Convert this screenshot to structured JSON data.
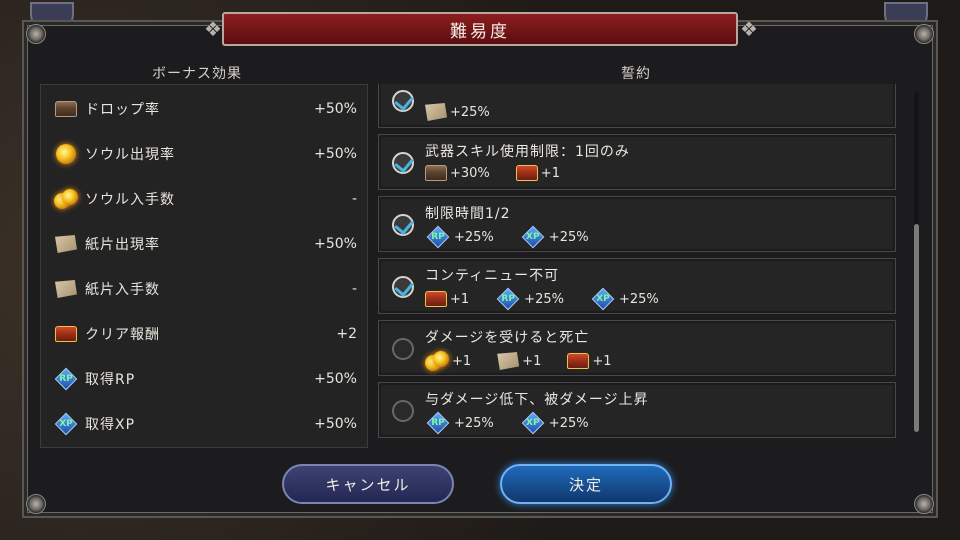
{
  "dialog": {
    "title": "難易度",
    "bonus_heading": "ボーナス効果",
    "oath_heading": "誓約"
  },
  "bonus_effects": [
    {
      "icon": "chest-icon",
      "label": "ドロップ率",
      "value": "+50%"
    },
    {
      "icon": "soul-icon",
      "label": "ソウル出現率",
      "value": "+50%"
    },
    {
      "icon": "soul-pair-icon",
      "label": "ソウル入手数",
      "value": "-"
    },
    {
      "icon": "paper-icon",
      "label": "紙片出現率",
      "value": "+50%"
    },
    {
      "icon": "paper-icon",
      "label": "紙片入手数",
      "value": "-"
    },
    {
      "icon": "red-chest-icon",
      "label": "クリア報酬",
      "value": "+2"
    },
    {
      "icon": "rp-icon",
      "label": "取得RP",
      "value": "+50%"
    },
    {
      "icon": "xp-icon",
      "label": "取得XP",
      "value": "+50%"
    }
  ],
  "oaths": [
    {
      "title": "",
      "checked": true,
      "rewards": [
        {
          "icon": "paper-icon",
          "text": "+25%"
        }
      ]
    },
    {
      "title": "武器スキル使用制限：1回のみ",
      "checked": true,
      "rewards": [
        {
          "icon": "chest-icon",
          "text": "+30%"
        },
        {
          "icon": "red-chest-icon",
          "text": "+1"
        }
      ]
    },
    {
      "title": "制限時間1/2",
      "checked": true,
      "rewards": [
        {
          "icon": "rp-icon",
          "text": "+25%"
        },
        {
          "icon": "xp-icon",
          "text": "+25%"
        }
      ]
    },
    {
      "title": "コンティニュー不可",
      "checked": true,
      "rewards": [
        {
          "icon": "red-chest-icon",
          "text": "+1"
        },
        {
          "icon": "rp-icon",
          "text": "+25%"
        },
        {
          "icon": "xp-icon",
          "text": "+25%"
        }
      ]
    },
    {
      "title": "ダメージを受けると死亡",
      "checked": false,
      "rewards": [
        {
          "icon": "soul-pair-icon",
          "text": "+1"
        },
        {
          "icon": "paper-icon",
          "text": "+1"
        },
        {
          "icon": "red-chest-icon",
          "text": "+1"
        }
      ]
    },
    {
      "title": "与ダメージ低下、被ダメージ上昇",
      "checked": false,
      "rewards": [
        {
          "icon": "rp-icon",
          "text": "+25%"
        },
        {
          "icon": "xp-icon",
          "text": "+25%"
        }
      ]
    }
  ],
  "icon_text": {
    "rp": "RP",
    "xp": "XP"
  },
  "buttons": {
    "cancel": "キャンセル",
    "confirm": "決定"
  },
  "colors": {
    "title_bar": "#8d1d1f",
    "checkmark": "#48b4e0",
    "confirm_button": "#1f6ab9",
    "cancel_button": "#3d4371"
  }
}
